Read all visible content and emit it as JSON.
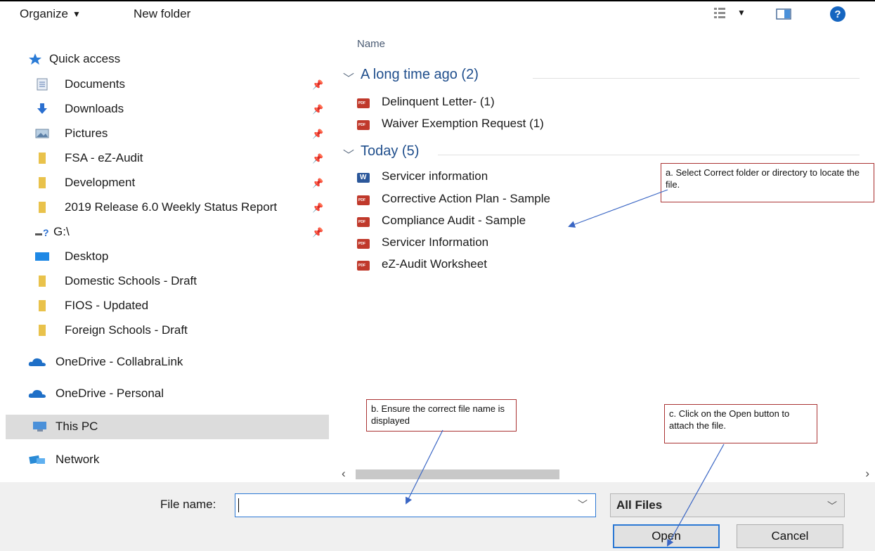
{
  "toolbar": {
    "organize_label": "Organize",
    "new_folder_label": "New folder"
  },
  "sidebar": {
    "items": [
      {
        "label": "Quick access",
        "icon": "star-icon"
      },
      {
        "label": "Documents",
        "icon": "documents-icon",
        "pinned": true
      },
      {
        "label": "Downloads",
        "icon": "download-arrow-icon",
        "pinned": true
      },
      {
        "label": "Pictures",
        "icon": "pictures-icon",
        "pinned": true
      },
      {
        "label": "FSA - eZ-Audit",
        "icon": "folder-icon",
        "pinned": true
      },
      {
        "label": "Development",
        "icon": "folder-icon",
        "pinned": true
      },
      {
        "label": "2019 Release 6.0 Weekly Status Report",
        "icon": "folder-icon",
        "pinned": true
      },
      {
        "label": "G:\\",
        "icon": "network-drive-icon",
        "pinned": true
      },
      {
        "label": "Desktop",
        "icon": "desktop-icon"
      },
      {
        "label": "Domestic Schools - Draft",
        "icon": "folder-icon"
      },
      {
        "label": "FIOS - Updated",
        "icon": "folder-icon"
      },
      {
        "label": "Foreign Schools - Draft",
        "icon": "folder-icon"
      },
      {
        "label": "OneDrive - CollabraLink",
        "icon": "cloud-icon"
      },
      {
        "label": "OneDrive - Personal",
        "icon": "cloud-icon"
      },
      {
        "label": "This PC",
        "icon": "computer-icon",
        "selected": true
      },
      {
        "label": "Network",
        "icon": "network-icon"
      }
    ]
  },
  "main": {
    "column_header": "Name",
    "groups": [
      {
        "title": "A long time ago (2)",
        "files": [
          {
            "name": "Delinquent Letter- (1)",
            "type": "pdf"
          },
          {
            "name": "Waiver Exemption Request (1)",
            "type": "pdf"
          }
        ]
      },
      {
        "title": "Today (5)",
        "files": [
          {
            "name": "Servicer information",
            "type": "word"
          },
          {
            "name": "Corrective Action Plan - Sample",
            "type": "pdf"
          },
          {
            "name": "Compliance Audit - Sample",
            "type": "pdf"
          },
          {
            "name": "Servicer Information",
            "type": "pdf"
          },
          {
            "name": "eZ-Audit Worksheet",
            "type": "pdf"
          }
        ]
      }
    ]
  },
  "callouts": {
    "a": "a. Select Correct folder or directory to locate the file.",
    "b": "b. Ensure the correct file name is displayed",
    "c": "c. Click on the Open button to attach the file."
  },
  "footer": {
    "file_name_label": "File name:",
    "file_name_value": "",
    "file_type_value": "All Files",
    "open_label": "Open",
    "cancel_label": "Cancel"
  },
  "colors": {
    "accent": "#2b78d4",
    "group_header": "#1f4e8c",
    "callout_border": "#aa3333",
    "selected_bg": "#dcdcdc",
    "folder": "#e9c24b"
  }
}
